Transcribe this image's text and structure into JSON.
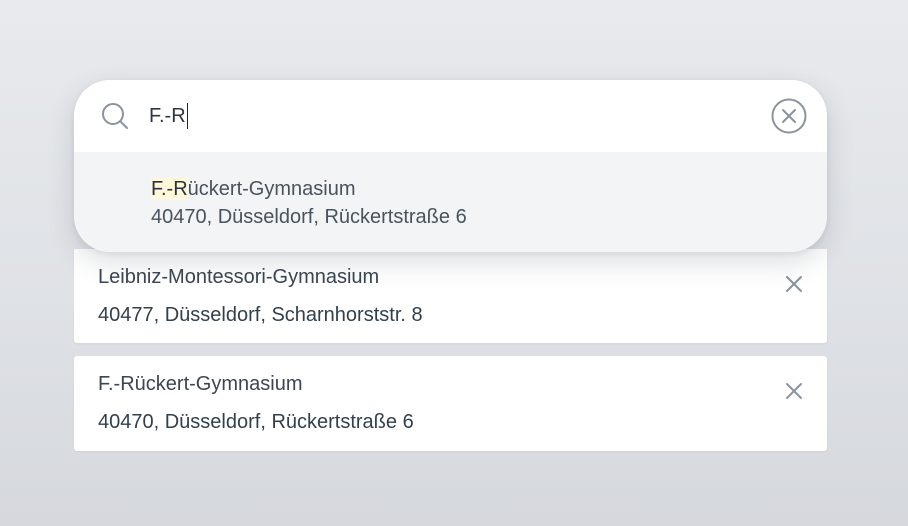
{
  "search": {
    "query": "F.-R",
    "suggestions": [
      {
        "match": "F.-R",
        "rest": "ückert-Gymnasium",
        "address": "40470, Düsseldorf, Rückertstraße 6"
      }
    ]
  },
  "schools": [
    {
      "name": "Leibniz-Montessori-Gymnasium",
      "address": "40477, Düsseldorf, Scharnhorststr. 8"
    },
    {
      "name": "F.-Rückert-Gymnasium",
      "address": "40470, Düsseldorf, Rückertstraße 6"
    }
  ],
  "icons": {
    "search": "search-icon",
    "clear": "clear-circle-icon",
    "remove": "close-icon"
  },
  "colors": {
    "highlight": "#fff8da",
    "icon": "#8a949e"
  }
}
